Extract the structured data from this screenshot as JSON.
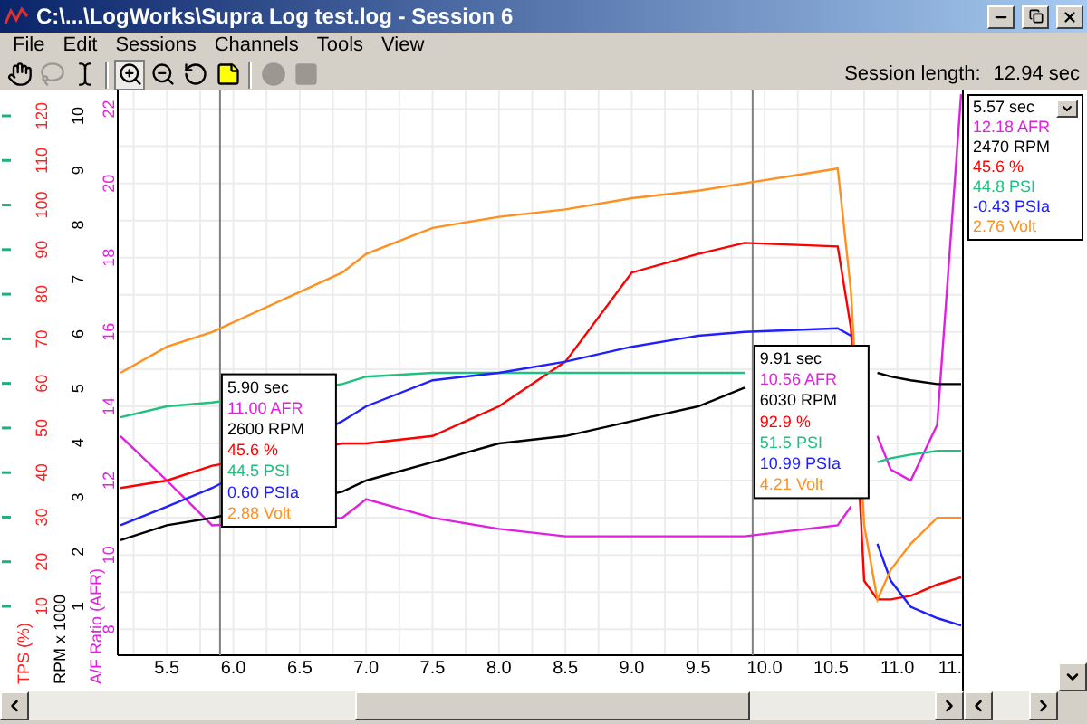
{
  "window": {
    "title": "C:\\...\\LogWorks\\Supra Log test.log - Session 6"
  },
  "menu": [
    "File",
    "Edit",
    "Sessions",
    "Channels",
    "Tools",
    "View"
  ],
  "toolbar": [
    {
      "kind": "hand",
      "pressed": false,
      "disabled": false
    },
    {
      "kind": "lasso",
      "pressed": false,
      "disabled": true
    },
    {
      "kind": "ibeam",
      "pressed": false,
      "disabled": false
    },
    {
      "kind": "separator"
    },
    {
      "kind": "zoom-in",
      "pressed": true,
      "disabled": false
    },
    {
      "kind": "zoom-out",
      "pressed": false,
      "disabled": false
    },
    {
      "kind": "reset",
      "pressed": false,
      "disabled": false
    },
    {
      "kind": "note",
      "pressed": false,
      "disabled": false
    },
    {
      "kind": "separator"
    },
    {
      "kind": "record",
      "pressed": false,
      "disabled": true
    },
    {
      "kind": "stop",
      "pressed": false,
      "disabled": true
    }
  ],
  "session_length": {
    "label": "Session length:",
    "value": "12.94 sec"
  },
  "left_axes": [
    {
      "kind": "marks",
      "color": "#20b080"
    },
    {
      "kind": "labeled",
      "title": "TPS (%)",
      "color": "#ff2020",
      "ticks": [
        "10",
        "20",
        "30",
        "40",
        "50",
        "60",
        "70",
        "80",
        "90",
        "100",
        "110",
        "120"
      ]
    },
    {
      "kind": "labeled",
      "title": "RPM x 1000",
      "color": "#000000",
      "ticks": [
        "1",
        "2",
        "3",
        "4",
        "5",
        "6",
        "7",
        "8",
        "9",
        "10"
      ]
    }
  ],
  "chart_data": {
    "type": "line",
    "ylabel": "A/F Ratio (AFR)",
    "xlim": [
      5.13,
      11.5
    ],
    "ylim": [
      7.3,
      22.5
    ],
    "xticks": [
      {
        "value": 5.5,
        "label": "5.5"
      },
      {
        "value": 6.0,
        "label": "6.0"
      },
      {
        "value": 6.5,
        "label": "6.5"
      },
      {
        "value": 7.0,
        "label": "7.0"
      },
      {
        "value": 7.5,
        "label": "7.5"
      },
      {
        "value": 8.0,
        "label": "8.0"
      },
      {
        "value": 8.5,
        "label": "8.5"
      },
      {
        "value": 9.0,
        "label": "9.0"
      },
      {
        "value": 9.5,
        "label": "9.5"
      },
      {
        "value": 10.0,
        "label": "10.0"
      },
      {
        "value": 10.5,
        "label": "10.5"
      },
      {
        "value": 11.0,
        "label": "11.0"
      },
      {
        "value": 11.5,
        "label": "11."
      }
    ],
    "yticks": [
      8,
      10,
      12,
      14,
      16,
      18,
      20,
      22
    ],
    "x": [
      5.15,
      5.5,
      5.84,
      6.82,
      7.0,
      7.5,
      8.0,
      8.5,
      9.0,
      9.5,
      9.85,
      10.55,
      10.65,
      10.75,
      10.85,
      10.95,
      11.1,
      11.3,
      11.48
    ],
    "grid": true,
    "series": [
      {
        "color": "#e020e0",
        "values": [
          13.2,
          12.0,
          10.8,
          11.0,
          11.5,
          11.0,
          10.7,
          10.5,
          10.5,
          10.5,
          10.5,
          10.8,
          11.3,
          null,
          13.2,
          12.3,
          12.0,
          13.5,
          22.4
        ]
      },
      {
        "color": "#000000",
        "values": [
          10.4,
          10.8,
          11.0,
          11.7,
          12.0,
          12.5,
          13.0,
          13.2,
          13.6,
          14.0,
          14.5,
          null,
          null,
          null,
          14.9,
          14.8,
          14.7,
          14.6,
          14.6
        ]
      },
      {
        "color": "#ff0000",
        "values": [
          11.8,
          12.0,
          12.4,
          13.0,
          13.0,
          13.2,
          14.0,
          15.2,
          17.6,
          18.1,
          18.4,
          18.3,
          16.1,
          9.3,
          8.8,
          8.8,
          8.9,
          9.2,
          9.4
        ]
      },
      {
        "color": "#20c080",
        "values": [
          13.7,
          14.0,
          14.1,
          14.6,
          14.8,
          14.9,
          14.9,
          14.9,
          14.9,
          14.9,
          14.9,
          null,
          null,
          null,
          12.5,
          12.6,
          12.7,
          12.8,
          12.8
        ]
      },
      {
        "color": "#2020ff",
        "values": [
          10.8,
          11.3,
          11.8,
          13.6,
          14.0,
          14.7,
          14.9,
          15.2,
          15.6,
          15.9,
          16.0,
          16.1,
          15.9,
          null,
          10.3,
          9.3,
          8.6,
          8.3,
          8.1
        ]
      },
      {
        "color": "#ff9020",
        "values": [
          14.9,
          15.6,
          16.0,
          17.6,
          18.1,
          18.8,
          19.1,
          19.3,
          19.6,
          19.8,
          20.0,
          20.4,
          17.1,
          10.8,
          8.8,
          9.6,
          10.3,
          11.0,
          11.0
        ]
      }
    ],
    "ref_lines": [
      {
        "axis": "x",
        "value": 5.9,
        "label": "5.90 sec"
      },
      {
        "axis": "x",
        "value": 9.91,
        "label": "9.91 sec"
      }
    ]
  },
  "cursors": [
    {
      "values": [
        "11.00 AFR",
        "2600 RPM",
        "45.6 %",
        "44.5 PSI",
        "0.60 PSIa",
        "2.88 Volt"
      ]
    },
    {
      "values": [
        "10.56 AFR",
        "6030 RPM",
        "92.9 %",
        "51.5 PSI",
        "10.99 PSIa",
        "4.21 Volt"
      ]
    }
  ],
  "readout_panel": {
    "time": "5.57 sec",
    "values": [
      "12.18 AFR",
      "2470 RPM",
      "45.6 %",
      "44.8 PSI",
      "-0.43 PSIa",
      "2.76 Volt"
    ]
  }
}
